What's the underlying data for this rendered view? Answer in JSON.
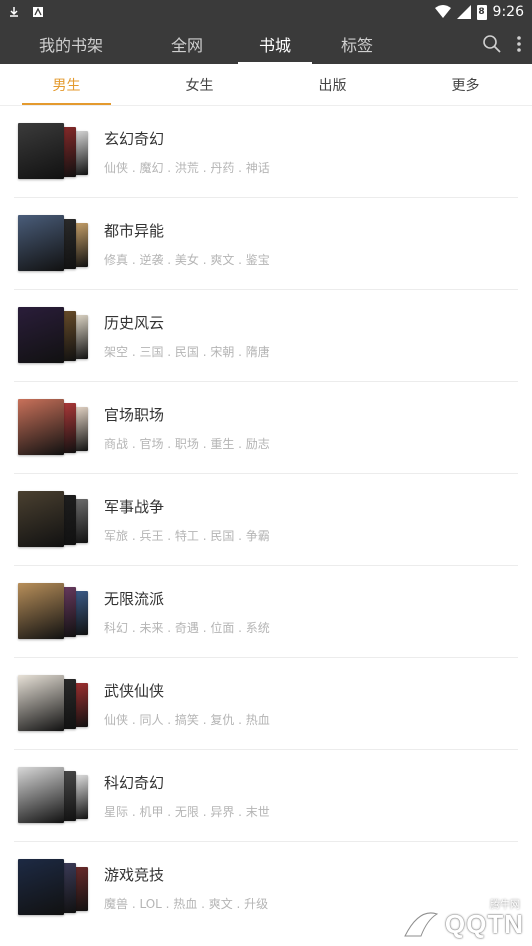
{
  "status_bar": {
    "time": "9:26",
    "battery_level": "8"
  },
  "top_tabs": [
    {
      "label": "我的书架"
    },
    {
      "label": "全网"
    },
    {
      "label": "书城"
    },
    {
      "label": "标签"
    }
  ],
  "sub_tabs": [
    {
      "label": "男生"
    },
    {
      "label": "女生"
    },
    {
      "label": "出版"
    },
    {
      "label": "更多"
    }
  ],
  "categories": [
    {
      "title": "玄幻奇幻",
      "tags": "仙侠 . 魔幻 . 洪荒 . 丹药 . 神话",
      "colors": [
        "#3b3b3b",
        "#8a2a2a",
        "#d9d9d9"
      ]
    },
    {
      "title": "都市异能",
      "tags": "修真 . 逆袭 . 美女 . 爽文 . 鉴宝",
      "colors": [
        "#4a5d7a",
        "#2b2b2b",
        "#c7a16a"
      ]
    },
    {
      "title": "历史风云",
      "tags": "架空 . 三国 . 民国 . 宋朝 . 隋唐",
      "colors": [
        "#2a1d3a",
        "#6b4e2a",
        "#e0d8c8"
      ]
    },
    {
      "title": "官场职场",
      "tags": "商战 . 官场 . 职场 . 重生 . 励志",
      "colors": [
        "#c9715a",
        "#b23a3a",
        "#e7d7c8"
      ]
    },
    {
      "title": "军事战争",
      "tags": "军旅 . 兵王 . 特工 . 民国 . 争霸",
      "colors": [
        "#4a4030",
        "#1e1e1e",
        "#6d6d6d"
      ]
    },
    {
      "title": "无限流派",
      "tags": "科幻 . 未来 . 奇遇 . 位面 . 系统",
      "colors": [
        "#b88f5a",
        "#6a3a60",
        "#3c5c8a"
      ]
    },
    {
      "title": "武侠仙侠",
      "tags": "仙侠 . 同人 . 搞笑 . 复仇 . 热血",
      "colors": [
        "#e8e2d8",
        "#2a2a2a",
        "#a03030"
      ]
    },
    {
      "title": "科幻奇幻",
      "tags": "星际 . 机甲 . 无限 . 异界 . 末世",
      "colors": [
        "#d8d8d8",
        "#4a4a4a",
        "#e2e2e2"
      ]
    },
    {
      "title": "游戏竞技",
      "tags": "魔兽 . LOL . 热血 . 爽文 . 升级",
      "colors": [
        "#1d2a44",
        "#3c3c5a",
        "#6a2a2a"
      ]
    }
  ],
  "watermark": {
    "logo_text": "QQTN",
    "tag_text": "腾牛网"
  },
  "theme": {
    "header_bg": "#3a3a3a",
    "accent": "#e49a2e"
  }
}
